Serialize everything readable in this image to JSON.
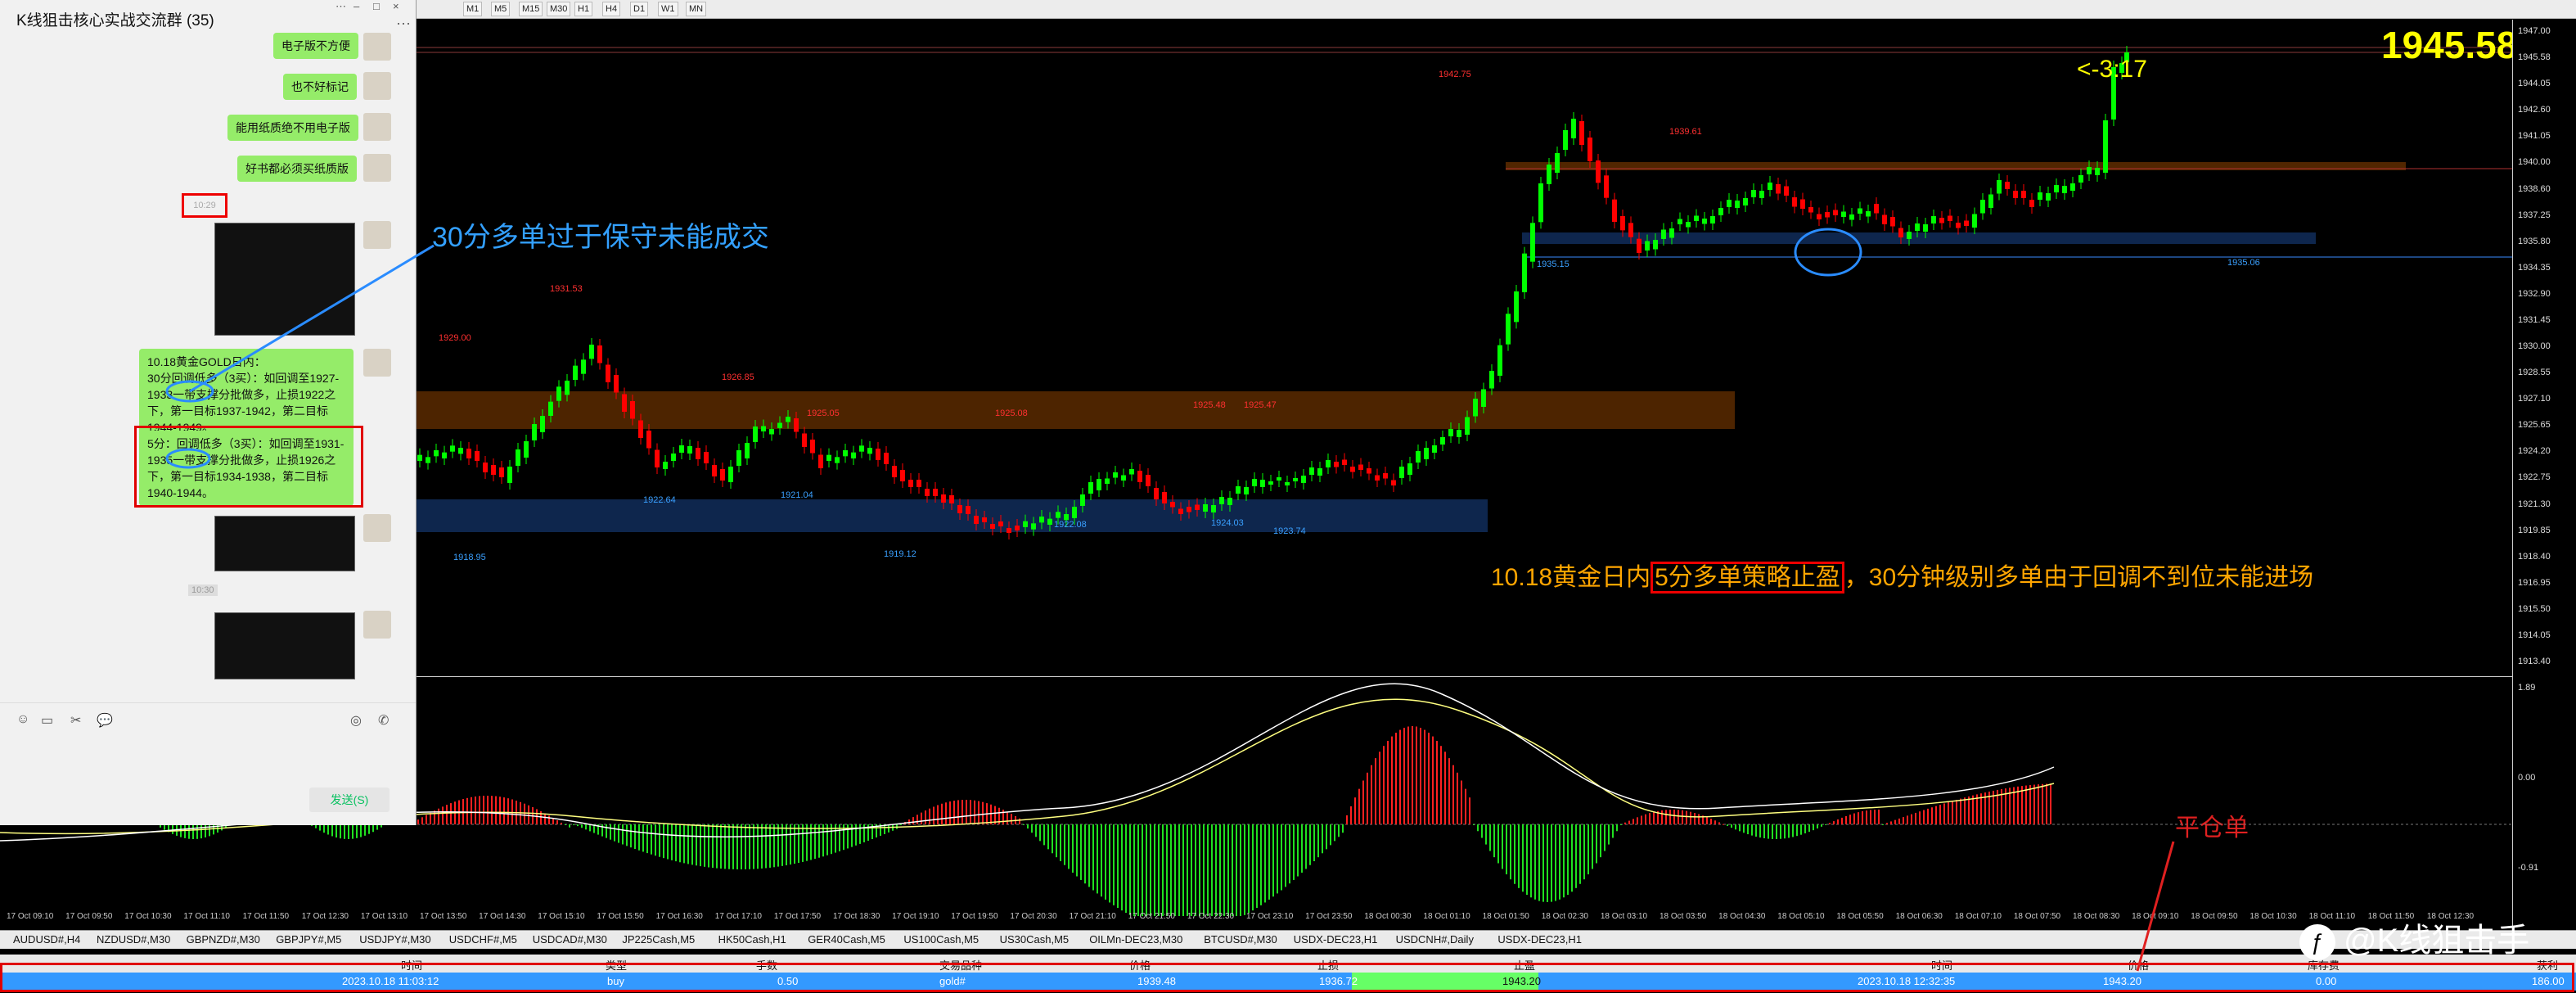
{
  "chat": {
    "title": "K线狙击核心实战交流群 (35)",
    "window_controls": [
      "⋯",
      "–",
      "□",
      "×"
    ],
    "more": "···",
    "messages": [
      {
        "text": "电子版不方便"
      },
      {
        "text": "也不好标记"
      },
      {
        "text": "能用纸质绝不用电子版"
      },
      {
        "text": "好书都必须买纸质版"
      },
      {
        "text": "10.18黄金GOLD日内：\n30分回调低多（3买）：如回调至1927-1933一带支撑分批做多，止损1922之下，第一目标1937-1942，第二目标1944-1949。"
      },
      {
        "text": "5分：回调低多（3买）：如回调至1931-1935一带支撑分批做多，止损1926之下，第一目标1934-1938，第二目标1940-1944。"
      }
    ],
    "time_marker": "10:29",
    "send_label": "发送(S)",
    "toolbar_icons": [
      "emoji-icon",
      "folder-icon",
      "screenshot-icon",
      "chat-history-icon",
      "live-icon",
      "call-icon"
    ]
  },
  "toolbar": {
    "timeframes": [
      "M1",
      "M5",
      "M15",
      "M30",
      "H1",
      "H4",
      "D1",
      "W1",
      "MN"
    ]
  },
  "chart": {
    "current_price": "1945.58",
    "countdown": "<-3:17",
    "price_ticks": [
      "1947.00",
      "1945.58",
      "1944.05",
      "1942.60",
      "1941.05",
      "1940.00",
      "1938.60",
      "1937.25",
      "1935.80",
      "1934.35",
      "1932.90",
      "1931.45",
      "1930.00",
      "1928.55",
      "1927.10",
      "1925.65",
      "1924.20",
      "1922.75",
      "1921.30",
      "1919.85",
      "1918.40",
      "1916.95",
      "1915.50",
      "1914.05",
      "1913.40"
    ],
    "indicator_ticks": [
      "1.89",
      "0.00",
      "-0.91"
    ],
    "price_labels_red": [
      "1942.75",
      "1939.61",
      "1931.53",
      "1929.00",
      "1926.85",
      "1925.05",
      "1925.08",
      "1925.48",
      "1925.47"
    ],
    "price_labels_blue": [
      "1935.15",
      "1935.06",
      "1922.64",
      "1921.04",
      "1922.08",
      "1924.03",
      "1923.74",
      "1918.95",
      "1919.12"
    ],
    "annotation_30min": "30分多单过于保守未能成交",
    "annotation_main_prefix": "10.18黄金日内",
    "annotation_main_box": "5分多单策略止盈",
    "annotation_main_suffix": "，30分钟级别多单由于回调不到位未能进场",
    "close_order_label": "平仓单",
    "colors": {
      "up": "#00ff00",
      "down": "#ff0000",
      "zone_resist": "#5a2a00",
      "zone_support": "#0f2a55",
      "label": "#ffff00"
    }
  },
  "time_axis": [
    "17 Oct 09:10",
    "17 Oct 09:50",
    "17 Oct 10:30",
    "17 Oct 11:10",
    "17 Oct 11:50",
    "17 Oct 12:30",
    "17 Oct 13:10",
    "17 Oct 13:50",
    "17 Oct 14:30",
    "17 Oct 15:10",
    "17 Oct 15:50",
    "17 Oct 16:30",
    "17 Oct 17:10",
    "17 Oct 17:50",
    "17 Oct 18:30",
    "17 Oct 19:10",
    "17 Oct 19:50",
    "17 Oct 20:30",
    "17 Oct 21:10",
    "17 Oct 21:50",
    "17 Oct 22:30",
    "17 Oct 23:10",
    "17 Oct 23:50",
    "18 Oct 00:30",
    "18 Oct 01:10",
    "18 Oct 01:50",
    "18 Oct 02:30",
    "18 Oct 03:10",
    "18 Oct 03:50",
    "18 Oct 04:30",
    "18 Oct 05:10",
    "18 Oct 05:50",
    "18 Oct 06:30",
    "18 Oct 07:10",
    "18 Oct 07:50",
    "18 Oct 08:30",
    "18 Oct 09:10",
    "18 Oct 09:50",
    "18 Oct 10:30",
    "18 Oct 11:10",
    "18 Oct 11:50",
    "18 Oct 12:30"
  ],
  "tabs": [
    "AUDUSD#,H4",
    "NZDUSD#,M30",
    "GBPNZD#,M30",
    "GBPJPY#,M5",
    "USDJPY#,M30",
    "USDCHF#,M5",
    "USDCAD#,M30",
    "JP225Cash,M5",
    "HK50Cash,H1",
    "GER40Cash,M5",
    "US100Cash,M5",
    "US30Cash,M5",
    "OILMn-DEC23,M30",
    "BTCUSD#,M30",
    "USDX-DEC23,H1",
    "USDCNH#,Daily",
    "USDX-DEC23,H1"
  ],
  "trade_table": {
    "headers": [
      "时间",
      "类型",
      "手数",
      "交易品种",
      "价格",
      "止损",
      "止盈",
      "时间",
      "价格",
      "库存费",
      "获利"
    ],
    "row": [
      "2023.10.18 11:03:12",
      "buy",
      "0.50",
      "gold#",
      "1939.48",
      "1936.72",
      "1943.20",
      "2023.10.18 12:32:35",
      "1943.20",
      "0.00",
      "186.00"
    ]
  },
  "watermark": "@K线狙击手"
}
